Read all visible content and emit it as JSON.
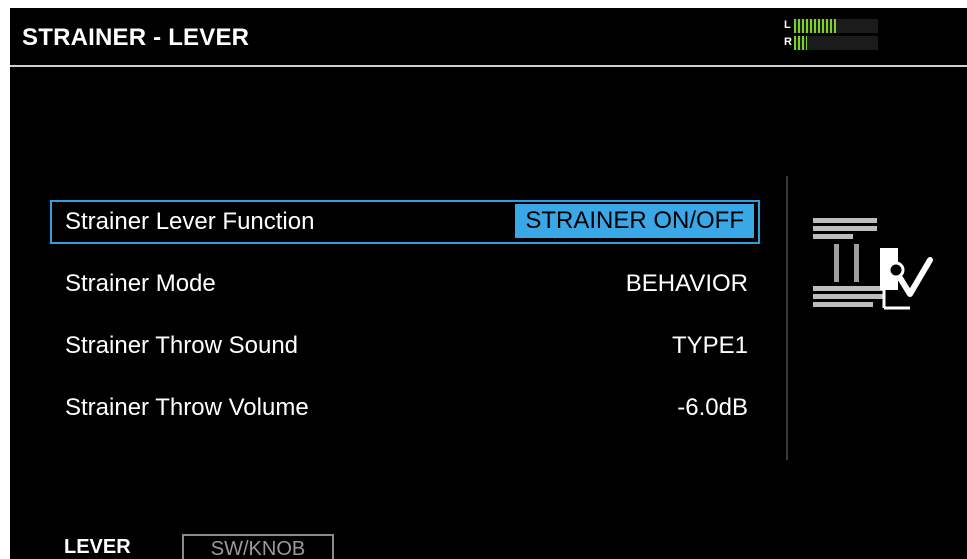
{
  "header": {
    "title": "STRAINER - LEVER",
    "meter": {
      "left_label": "L",
      "right_label": "R",
      "left_level": 0.5,
      "right_level": 0.15
    }
  },
  "params": [
    {
      "label": "Strainer Lever Function",
      "value": "STRAINER ON/OFF",
      "selected": true
    },
    {
      "label": "Strainer Mode",
      "value": "BEHAVIOR",
      "selected": false
    },
    {
      "label": "Strainer Throw Sound",
      "value": "TYPE1",
      "selected": false
    },
    {
      "label": "Strainer Throw Volume",
      "value": "-6.0dB",
      "selected": false
    }
  ],
  "icon": {
    "name": "strainer-lever-icon"
  },
  "footer": {
    "tabs": [
      {
        "label": "LEVER",
        "active": true
      },
      {
        "label": "SW/KNOB",
        "active": false
      }
    ]
  },
  "colors": {
    "background": "#000000",
    "text": "#ffffff",
    "accent": "#3aa7e6",
    "meter": "#7ed321"
  }
}
